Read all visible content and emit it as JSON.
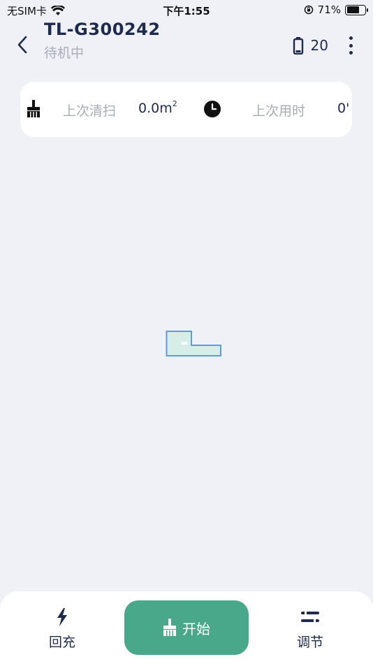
{
  "status_bar": {
    "carrier": "无SIM卡",
    "time": "下午1:55",
    "battery_percent": "71%",
    "battery_level": 0.71
  },
  "header": {
    "title": "TL-G300242",
    "subtitle": "待机中",
    "battery_value": "20",
    "back_icon": "chevron-left-icon",
    "battery_icon": "battery-icon",
    "more_icon": "more-vertical-icon"
  },
  "info_card": {
    "last_clean_label": "上次清扫",
    "last_clean_value": "0.0m",
    "last_clean_unit_sup": "2",
    "last_time_label": "上次用时",
    "last_time_value": "0'"
  },
  "bottom_nav": {
    "recharge_label": "回充",
    "start_label": "开始",
    "adjust_label": "调节"
  },
  "colors": {
    "accent": "#4aa88a",
    "text_primary": "#1e2b4d",
    "text_muted": "#a7acb8",
    "background": "#f0f1f7",
    "map_fill": "#d7ede8",
    "map_stroke": "#5b9be6"
  }
}
